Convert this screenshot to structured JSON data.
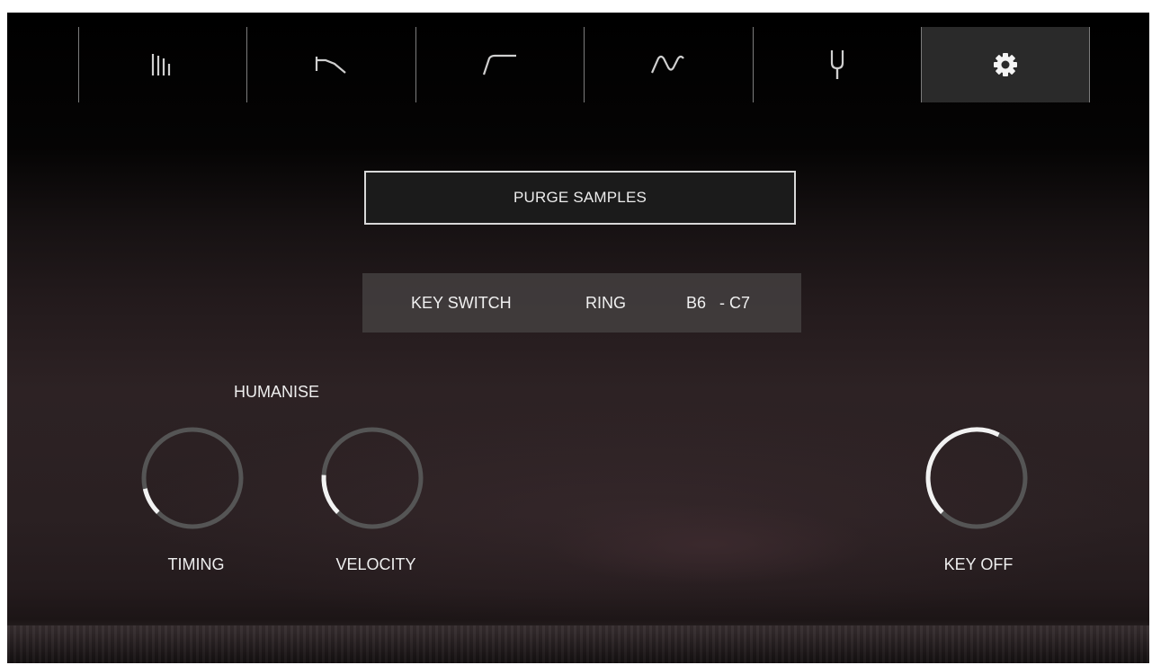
{
  "tabs": [
    {
      "icon": "mixer-bars-icon"
    },
    {
      "icon": "lowpass-filter-icon"
    },
    {
      "icon": "highpass-filter-icon"
    },
    {
      "icon": "lfo-wave-icon"
    },
    {
      "icon": "tuning-fork-icon"
    },
    {
      "icon": "gear-icon",
      "active": true
    }
  ],
  "purge_button": {
    "label": "PURGE SAMPLES"
  },
  "key_switch": {
    "label": "KEY SWITCH",
    "mode": "RING",
    "range": "B6   - C7"
  },
  "humanise": {
    "title": "HUMANISE"
  },
  "knobs": {
    "timing": {
      "label": "TIMING",
      "value": 0.12
    },
    "velocity": {
      "label": "VELOCITY",
      "value": 0.18
    },
    "key_off": {
      "label": "KEY OFF",
      "value": 0.6
    }
  },
  "colors": {
    "knob_track": "#555555",
    "knob_value": "#f2f2f2",
    "text": "#eeeeee",
    "active_tab": "#2a2a2a"
  }
}
